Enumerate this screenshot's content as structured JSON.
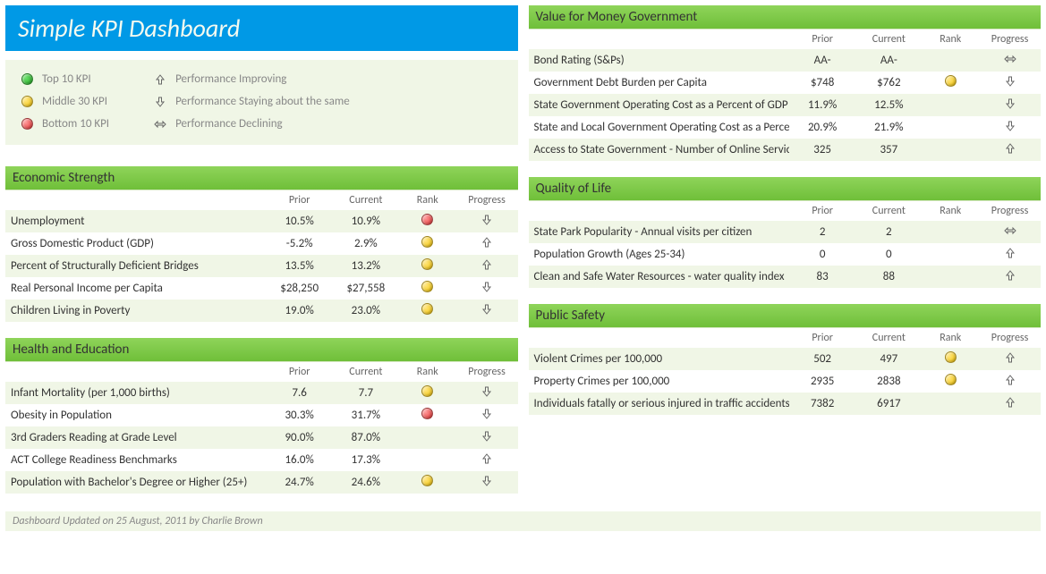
{
  "title": "Simple KPI Dashboard",
  "legend": {
    "ranks": [
      {
        "color": "green",
        "label": "Top 10 KPI"
      },
      {
        "color": "yellow",
        "label": "Middle 30 KPI"
      },
      {
        "color": "red",
        "label": "Bottom 10 KPI"
      }
    ],
    "progress": [
      {
        "icon": "up",
        "label": "Performance Improving"
      },
      {
        "icon": "down",
        "label": "Performance Staying about the same"
      },
      {
        "icon": "flat",
        "label": "Performance Declining"
      }
    ]
  },
  "columns": [
    "Prior",
    "Current",
    "Rank",
    "Progress"
  ],
  "panels_left": [
    {
      "title": "Economic Strength",
      "rows": [
        {
          "label": "Unemployment",
          "prior": "10.5%",
          "current": "10.9%",
          "rank": "red",
          "progress": "down"
        },
        {
          "label": "Gross Domestic Product (GDP)",
          "prior": "-5.2%",
          "current": "2.9%",
          "rank": "yellow",
          "progress": "up"
        },
        {
          "label": "Percent of Structurally Deficient Bridges",
          "prior": "13.5%",
          "current": "13.2%",
          "rank": "yellow",
          "progress": "up"
        },
        {
          "label": "Real Personal Income per Capita",
          "prior": "$28,250",
          "current": "$27,558",
          "rank": "yellow",
          "progress": "down"
        },
        {
          "label": "Children Living in Poverty",
          "prior": "19.0%",
          "current": "23.0%",
          "rank": "yellow",
          "progress": "down"
        }
      ]
    },
    {
      "title": "Health and Education",
      "rows": [
        {
          "label": "Infant Mortality (per 1,000 births)",
          "prior": "7.6",
          "current": "7.7",
          "rank": "yellow",
          "progress": "down"
        },
        {
          "label": "Obesity in Population",
          "prior": "30.3%",
          "current": "31.7%",
          "rank": "red",
          "progress": "down"
        },
        {
          "label": "3rd Graders Reading at Grade Level",
          "prior": "90.0%",
          "current": "87.0%",
          "rank": "",
          "progress": "down"
        },
        {
          "label": "ACT College Readiness Benchmarks",
          "prior": "16.0%",
          "current": "17.3%",
          "rank": "",
          "progress": "up"
        },
        {
          "label": "Population with Bachelor's Degree or Higher (25+)",
          "prior": "24.7%",
          "current": "24.6%",
          "rank": "yellow",
          "progress": "down"
        }
      ]
    }
  ],
  "panels_right": [
    {
      "title": "Value for Money Government",
      "rows": [
        {
          "label": "Bond Rating (S&Ps)",
          "prior": "AA-",
          "current": "AA-",
          "rank": "",
          "progress": "flat"
        },
        {
          "label": "Government Debt Burden per Capita",
          "prior": "$748",
          "current": "$762",
          "rank": "yellow",
          "progress": "down"
        },
        {
          "label": "State Government Operating Cost as a Percent of GDP",
          "prior": "11.9%",
          "current": "12.5%",
          "rank": "",
          "progress": "down"
        },
        {
          "label": "State and Local Government Operating Cost as a Percent of GDP",
          "prior": "20.9%",
          "current": "21.9%",
          "rank": "",
          "progress": "down"
        },
        {
          "label": "Access to State Government - Number of Online Services",
          "prior": "325",
          "current": "357",
          "rank": "",
          "progress": "up"
        }
      ]
    },
    {
      "title": "Quality of Life",
      "rows": [
        {
          "label": "State Park Popularity - Annual visits per citizen",
          "prior": "2",
          "current": "2",
          "rank": "",
          "progress": "flat"
        },
        {
          "label": "Population Growth (Ages 25-34)",
          "prior": "0",
          "current": "0",
          "rank": "",
          "progress": "up"
        },
        {
          "label": "Clean and Safe Water Resources - water quality index",
          "prior": "83",
          "current": "88",
          "rank": "",
          "progress": "up"
        }
      ]
    },
    {
      "title": "Public Safety",
      "rows": [
        {
          "label": "Violent Crimes per 100,000",
          "prior": "502",
          "current": "497",
          "rank": "yellow",
          "progress": "up"
        },
        {
          "label": "Property Crimes per 100,000",
          "prior": "2935",
          "current": "2838",
          "rank": "yellow",
          "progress": "up"
        },
        {
          "label": "Individuals fatally or serious injured in traffic accidents",
          "prior": "7382",
          "current": "6917",
          "rank": "",
          "progress": "up"
        }
      ]
    }
  ],
  "footer": "Dashboard Updated on 25 August, 2011 by Charlie Brown",
  "chart_data": {
    "type": "table",
    "note": "KPI dashboard rendered as grouped tables; numeric values are in panels_left / panels_right above."
  }
}
